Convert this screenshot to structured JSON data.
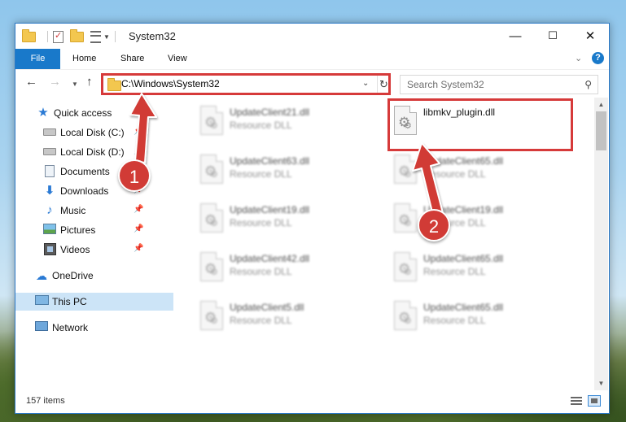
{
  "window": {
    "title": "System32",
    "controls": {
      "minimize": "—",
      "maximize": "☐",
      "close": "✕"
    }
  },
  "ribbon": {
    "tabs": [
      "File",
      "Home",
      "Share",
      "View"
    ],
    "help": "?"
  },
  "address": {
    "path": "C:\\Windows\\System32",
    "search_placeholder": "Search System32"
  },
  "sidebar": {
    "items": [
      {
        "label": "Quick access",
        "icon": "star-icon"
      },
      {
        "label": "Local Disk (C:)",
        "icon": "drive-icon",
        "pinned": true
      },
      {
        "label": "Local Disk (D:)",
        "icon": "drive-icon",
        "pinned": true
      },
      {
        "label": "Documents",
        "icon": "documents-icon",
        "pinned": true
      },
      {
        "label": "Downloads",
        "icon": "download-icon",
        "pinned": true
      },
      {
        "label": "Music",
        "icon": "music-icon",
        "pinned": true
      },
      {
        "label": "Pictures",
        "icon": "pictures-icon",
        "pinned": true
      },
      {
        "label": "Videos",
        "icon": "videos-icon",
        "pinned": true
      },
      {
        "label": "OneDrive",
        "icon": "cloud-icon"
      },
      {
        "label": "This PC",
        "icon": "computer-icon",
        "selected": true
      },
      {
        "label": "Network",
        "icon": "network-icon"
      }
    ]
  },
  "files": [
    {
      "name": "UpdateClient21.dll",
      "type": "Resource DLL",
      "blurred": true
    },
    {
      "name": "libmkv_plugin.dll",
      "type": "",
      "blurred": false,
      "highlighted": true
    },
    {
      "name": "UpdateClient63.dll",
      "type": "Resource DLL",
      "blurred": true
    },
    {
      "name": "UpdateClient65.dll",
      "type": "Resource DLL",
      "blurred": true
    },
    {
      "name": "UpdateClient19.dll",
      "type": "Resource DLL",
      "blurred": true
    },
    {
      "name": "UpdateClient19.dll",
      "type": "Resource DLL",
      "blurred": true
    },
    {
      "name": "UpdateClient42.dll",
      "type": "Resource DLL",
      "blurred": true
    },
    {
      "name": "UpdateClient65.dll",
      "type": "Resource DLL",
      "blurred": true
    },
    {
      "name": "UpdateClient5.dll",
      "type": "Resource DLL",
      "blurred": true
    },
    {
      "name": "UpdateClient65.dll",
      "type": "Resource DLL",
      "blurred": true
    }
  ],
  "status": {
    "count": "157 items"
  },
  "annotations": {
    "step1": "1",
    "step2": "2",
    "color": "#d13b36"
  },
  "colors": {
    "accent": "#1979ca",
    "selection": "#cce4f7",
    "highlight": "#d63a3a"
  }
}
